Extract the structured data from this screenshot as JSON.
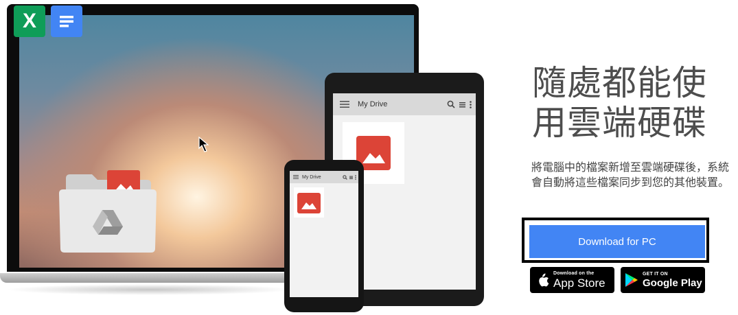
{
  "hero": {
    "app_icons": [
      {
        "name": "sheets-icon",
        "glyph": "X",
        "color": "#0f9d58"
      },
      {
        "name": "docs-icon",
        "color": "#4285f4"
      }
    ],
    "tablet": {
      "toolbar_title": "My Drive"
    },
    "phone": {
      "toolbar_title": "My Drive"
    },
    "drive_folder_color": "#e9e9e9",
    "photo_color": "#dc4437"
  },
  "content": {
    "headline": "隨處都能使\n用雲端硬碟",
    "description": "將電腦中的檔案新增至雲端硬碟後，系統會自動將這些檔案同步到您的其他裝置。",
    "download_button": "Download for PC",
    "download_color": "#4285f4",
    "app_store": {
      "small": "Download on the",
      "big": "App Store"
    },
    "google_play": {
      "small": "GET IT ON",
      "big": "Google Play"
    }
  }
}
